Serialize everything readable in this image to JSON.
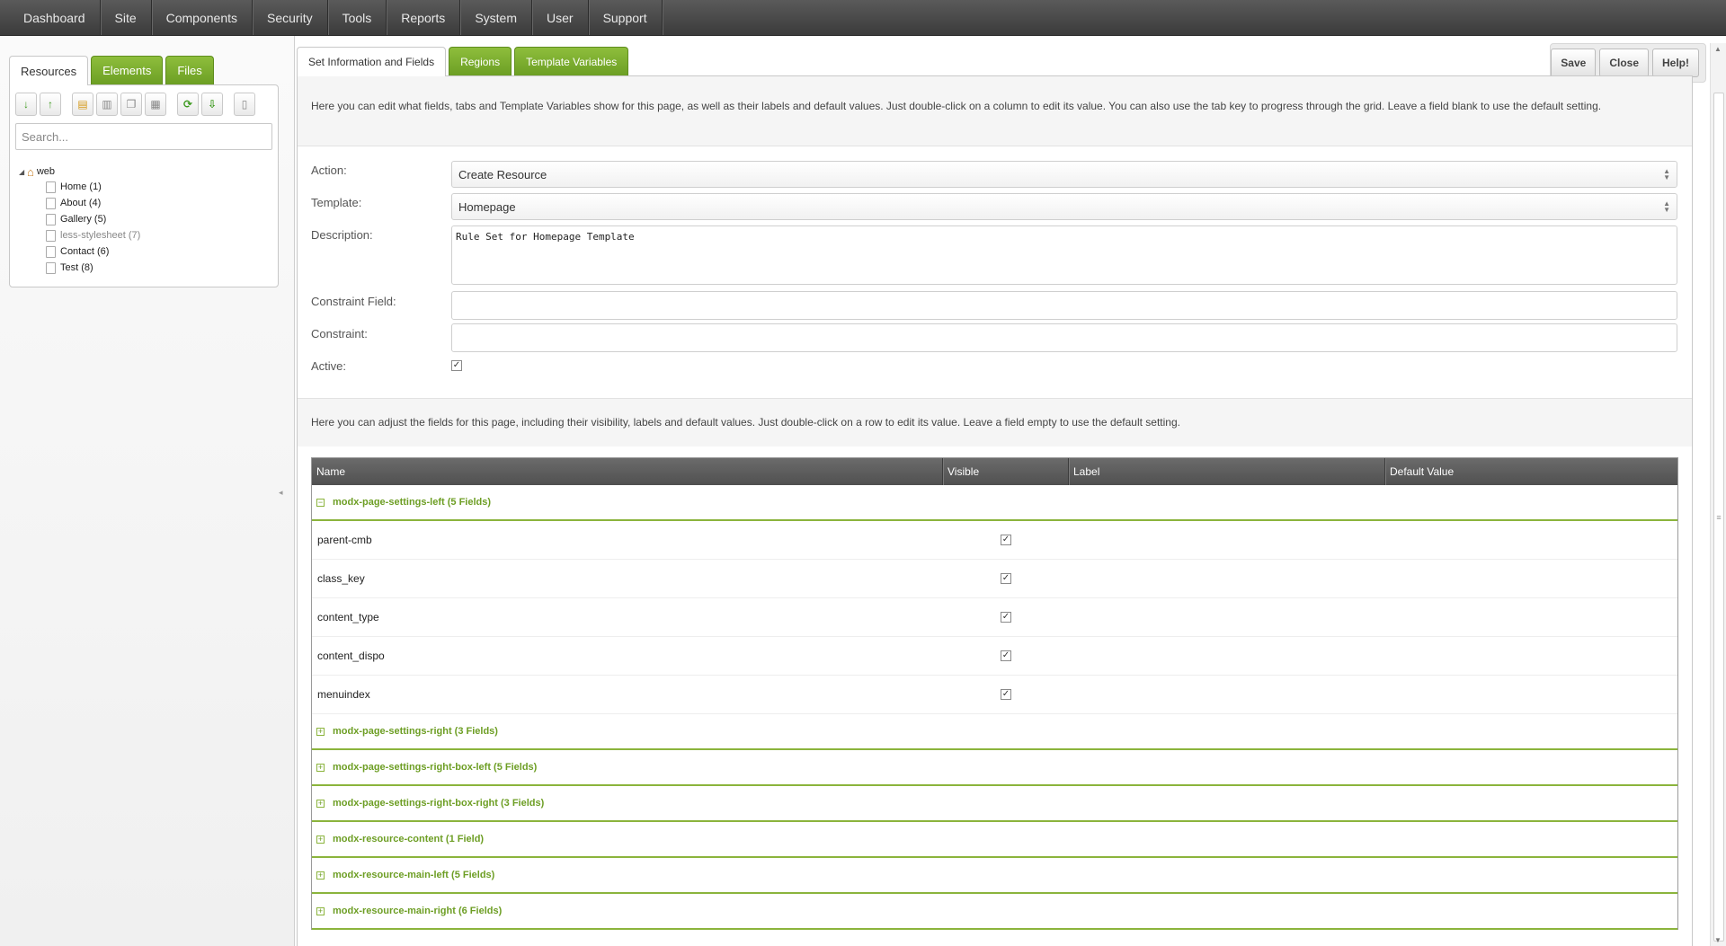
{
  "nav": [
    "Dashboard",
    "Site",
    "Components",
    "Security",
    "Tools",
    "Reports",
    "System",
    "User",
    "Support"
  ],
  "left_tabs": [
    "Resources",
    "Elements",
    "Files"
  ],
  "search": {
    "placeholder": "Search..."
  },
  "tree": {
    "root": "web",
    "items": [
      {
        "label": "Home",
        "id": "(1)"
      },
      {
        "label": "About",
        "id": "(4)"
      },
      {
        "label": "Gallery",
        "id": "(5)"
      },
      {
        "label": "less-stylesheet",
        "id": "(7)"
      },
      {
        "label": "Contact",
        "id": "(6)"
      },
      {
        "label": "Test",
        "id": "(8)"
      }
    ]
  },
  "main_tabs": [
    "Set Information and Fields",
    "Regions",
    "Template Variables"
  ],
  "buttons": {
    "save": "Save",
    "close": "Close",
    "help": "Help!"
  },
  "intro": "Here you can edit what fields, tabs and Template Variables show for this page, as well as their labels and default values. Just double-click on a column to edit its value. You can also use the tab key to progress through the grid. Leave a field blank to use the default setting.",
  "form": {
    "action_label": "Action:",
    "action_value": "Create Resource",
    "template_label": "Template:",
    "template_value": "Homepage",
    "description_label": "Description:",
    "description_value": "Rule Set for Homepage Template",
    "constraint_field_label": "Constraint Field:",
    "constraint_label": "Constraint:",
    "active_label": "Active:",
    "active_checked": true
  },
  "fields_intro": "Here you can adjust the fields for this page, including their visibility, labels and default values. Just double-click on a row to edit its value. Leave a field empty to use the default setting.",
  "grid": {
    "columns": [
      "Name",
      "Visible",
      "Label",
      "Default Value"
    ],
    "expanded_group": "modx-page-settings-left (5 Fields)",
    "rows": [
      "parent-cmb",
      "class_key",
      "content_type",
      "content_dispo",
      "menuindex"
    ],
    "collapsed_groups": [
      "modx-page-settings-right (3 Fields)",
      "modx-page-settings-right-box-left (5 Fields)",
      "modx-page-settings-right-box-right (3 Fields)",
      "modx-resource-content (1 Field)",
      "modx-resource-main-left (5 Fields)",
      "modx-resource-main-right (6 Fields)"
    ]
  },
  "colors": {
    "accent_green": "#6d9e24",
    "nav_bg": "#4a4a4a"
  }
}
